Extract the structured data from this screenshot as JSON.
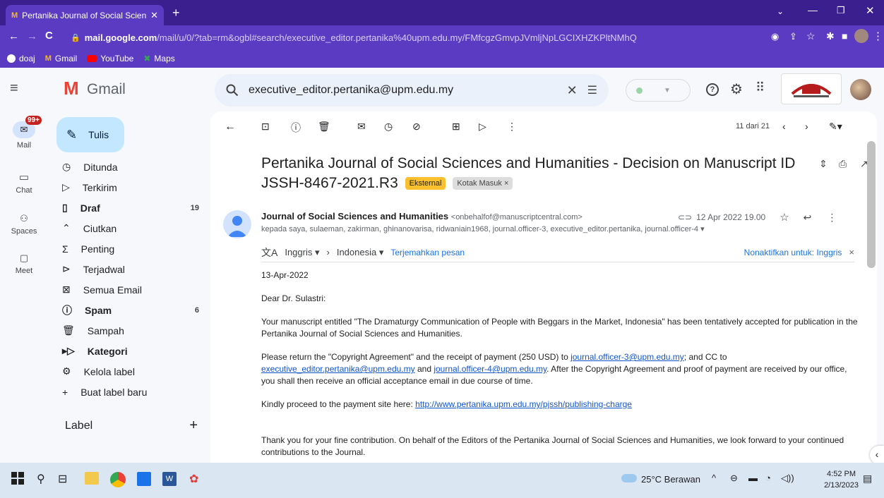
{
  "browser": {
    "tab_title": "Pertanika Journal of Social Scienc",
    "url_domain": "mail.google.com",
    "url_path": "/mail/u/0/?tab=rm&ogbl#search/executive_editor.pertanika%40upm.edu.my/FMfcgzGmvpJVmljNpLGCIXHZKPltNMhQ",
    "bookmarks": [
      {
        "label": "doaj",
        "icon": "doaj-icon"
      },
      {
        "label": "Gmail",
        "icon": "gmail-icon"
      },
      {
        "label": "YouTube",
        "icon": "youtube-icon"
      },
      {
        "label": "Maps",
        "icon": "maps-icon"
      }
    ]
  },
  "header": {
    "app_name": "Gmail",
    "search_query": "executive_editor.pertanika@upm.edu.my"
  },
  "rail": {
    "mail_badge": "99+",
    "items": [
      {
        "label": "Mail"
      },
      {
        "label": "Chat"
      },
      {
        "label": "Spaces"
      },
      {
        "label": "Meet"
      }
    ]
  },
  "nav": {
    "compose_label": "Tulis",
    "items": [
      {
        "label": "Ditunda",
        "count": "",
        "bold": false,
        "icon": "clock-icon"
      },
      {
        "label": "Terkirim",
        "count": "",
        "bold": false,
        "icon": "send-icon"
      },
      {
        "label": "Draf",
        "count": "19",
        "bold": true,
        "icon": "draft-icon"
      },
      {
        "label": "Ciutkan",
        "count": "",
        "bold": false,
        "icon": "chevron-up-icon"
      },
      {
        "label": "Penting",
        "count": "",
        "bold": false,
        "icon": "important-icon"
      },
      {
        "label": "Terjadwal",
        "count": "",
        "bold": false,
        "icon": "scheduled-icon"
      },
      {
        "label": "Semua Email",
        "count": "",
        "bold": false,
        "icon": "all-mail-icon"
      },
      {
        "label": "Spam",
        "count": "6",
        "bold": true,
        "icon": "spam-icon"
      },
      {
        "label": "Sampah",
        "count": "",
        "bold": false,
        "icon": "trash-icon"
      },
      {
        "label": "Kategori",
        "count": "",
        "bold": true,
        "icon": "label-icon"
      },
      {
        "label": "Kelola label",
        "count": "",
        "bold": false,
        "icon": "gear-icon"
      },
      {
        "label": "Buat label baru",
        "count": "",
        "bold": false,
        "icon": "plus-icon"
      }
    ],
    "label_heading": "Label"
  },
  "message": {
    "pager": "11 dari 21",
    "subject_line1": "Pertanika Journal of Social Sciences and Humanities - Decision on Manuscript ID",
    "subject_line2": "JSSH-8467-2021.R3",
    "chip_external": "Eksternal",
    "chip_inbox": "Kotak Masuk ×",
    "sender_name": "Journal of Social Sciences and Humanities",
    "sender_email": "<onbehalfof@manuscriptcentral.com>",
    "recipients": "kepada saya, sulaeman, zakirman, ghinanovarisa, ridwaniain1968, journal.officer-3, executive_editor.pertanika, journal.officer-4 ▾",
    "date": "12 Apr 2022 19.00",
    "translate": {
      "from": "Inggris ▾",
      "to": "Indonesia ▾",
      "translate_link": "Terjemahkan pesan",
      "disable_link": "Nonaktifkan untuk: Inggris"
    },
    "body": {
      "date_line": "13-Apr-2022",
      "greeting": "Dear Dr. Sulastri:",
      "para1": "Your manuscript entitled \"The Dramaturgy Communication of People with Beggars in the Market, Indonesia\" has been tentatively accepted for publication in the Pertanika Journal of Social Sciences and Humanities.",
      "para2_a": "Please return the \"Copyright Agreement\" and the receipt of payment (250 USD) to ",
      "para2_link1": "journal.officer-3@upm.edu.my",
      "para2_b": "; and CC to ",
      "para2_link2": "executive_editor.pertanika@upm.edu.my",
      "para2_c": " and ",
      "para2_link3": "journal.officer-4@upm.edu.my",
      "para2_d": ". After the Copyright Agreement and proof of payment are received by our office, you shall then receive an official acceptance email in due course of time.",
      "para3_a": "Kindly proceed to the payment site here: ",
      "para3_link": "http://www.pertanika.upm.edu.my/pjssh/publishing-charge",
      "para4": "Thank you for your fine contribution. On behalf of the Editors of the Pertanika Journal of Social Sciences and Humanities, we look forward to your continued contributions to the Journal."
    }
  },
  "taskbar": {
    "weather": "25°C Berawan",
    "time": "4:52 PM",
    "date": "2/13/2023"
  },
  "colors": {
    "browser_dark": "#3c1f8e",
    "browser_main": "#5b3bc1",
    "compose": "#c2e7ff",
    "search_bg": "#eaf1fb",
    "external_chip": "#fbc02d",
    "link": "#1155cc"
  }
}
